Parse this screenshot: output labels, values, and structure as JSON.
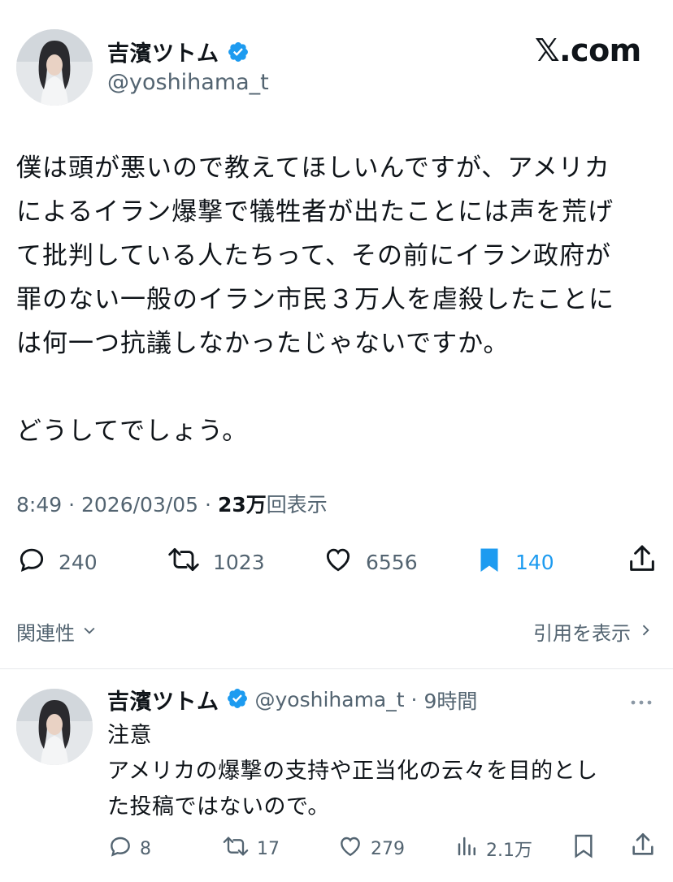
{
  "tweet": {
    "author_name": "吉濱ツトム",
    "handle": "@yoshihama_t",
    "logo": "𝕏.com",
    "body": "僕は頭が悪いので教えてほしいんですが、アメリカ\nによるイラン爆撃で犠牲者が出たことには声を荒げ\nて批判している人たちって、その前にイラン政府が\n罪のない一般のイラン市民３万人を虐殺したことに\nは何一つ抗議しなかったじゃないですか。\n\nどうしてでしょう。",
    "time": "8:49",
    "date": "2026/03/05",
    "views_count": "23万",
    "views_label": "回表示",
    "separator": "·",
    "stats": {
      "replies": "240",
      "reposts": "1023",
      "likes": "6556",
      "bookmarks": "140"
    },
    "bookmarked": true
  },
  "links": {
    "related": "関連性",
    "quotes": "引用を表示"
  },
  "reply": {
    "author_name": "吉濱ツトム",
    "handle": "@yoshihama_t",
    "time_ago": "9時間",
    "separator": "·",
    "body": "注意\nアメリカの爆撃の支持や正当化の云々を目的とし\nた投稿ではないので。",
    "stats": {
      "replies": "8",
      "reposts": "17",
      "likes": "279",
      "views": "2.1万"
    }
  },
  "colors": {
    "verified": "#1d9bf0",
    "bookmark_active": "#1d9bf0",
    "secondary_text": "#536471"
  },
  "icons": {
    "verified": "verified-badge-icon",
    "reply": "reply-icon",
    "repost": "repost-icon",
    "like": "heart-icon",
    "bookmark": "bookmark-icon",
    "share": "share-icon",
    "views": "views-chart-icon",
    "more": "more-icon",
    "chevron_down": "chevron-down-icon",
    "chevron_right": "chevron-right-icon"
  }
}
